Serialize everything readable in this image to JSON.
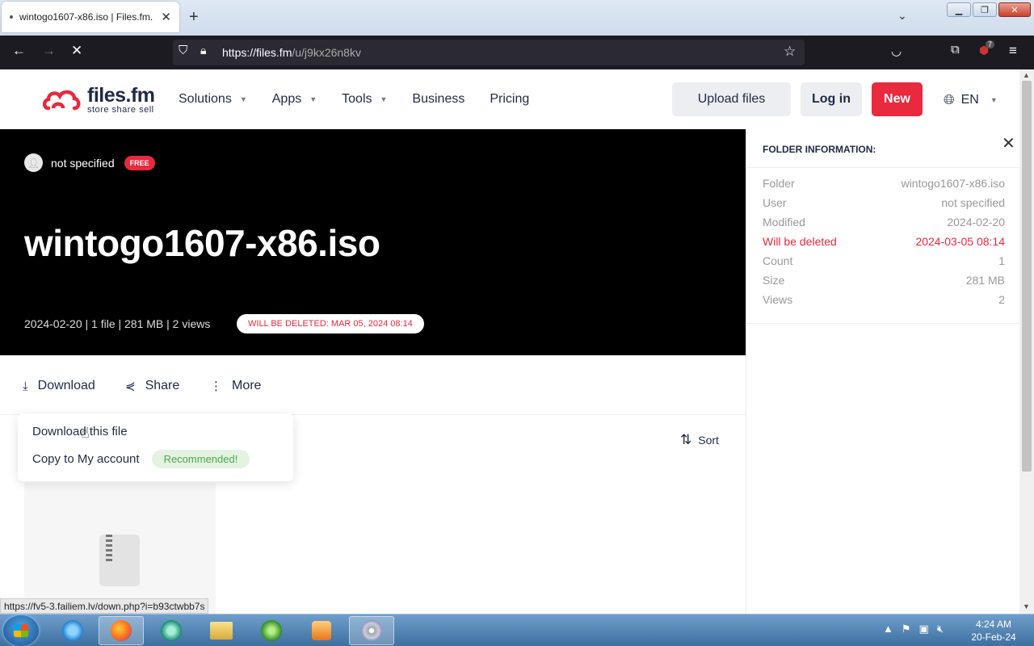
{
  "browser": {
    "tab_title": "wintogo1607-x86.iso | Files.fm.",
    "tab_close": "✕",
    "new_tab": "+",
    "url_host": "https://files.fm",
    "url_path": "/u/j9kx26n8kv",
    "extension_badge": "7",
    "status_url": "https://fv5-3.failiem.lv/down.php?i=b93ctwbb7s"
  },
  "header": {
    "logo_brand": "files.fm",
    "logo_tagline": "store share sell",
    "menu": [
      {
        "label": "Solutions",
        "has_caret": true
      },
      {
        "label": "Apps",
        "has_caret": true
      },
      {
        "label": "Tools",
        "has_caret": true
      },
      {
        "label": "Business",
        "has_caret": false
      },
      {
        "label": "Pricing",
        "has_caret": false
      }
    ],
    "upload_label": "Upload files",
    "login_label": "Log in",
    "new_label": "New",
    "language": "EN"
  },
  "hero": {
    "owner": "not specified",
    "plan_badge": "FREE",
    "title": "wintogo1607-x86.iso",
    "meta": "2024-02-20 | 1 file | 281 MB | 2 views",
    "deletion_notice": "WILL BE DELETED: MAR 05, 2024 08:14"
  },
  "actions": {
    "download": "Download",
    "share": "Share",
    "more": "More",
    "sort": "Sort"
  },
  "dropdown": {
    "download_file": "Download this file",
    "copy_account": "Copy to My account",
    "recommended": "Recommended!"
  },
  "folder_info": {
    "title": "FOLDER INFORMATION:",
    "rows": [
      {
        "label": "Folder",
        "value": "wintogo1607-x86.iso"
      },
      {
        "label": "User",
        "value": "not specified"
      },
      {
        "label": "Modified",
        "value": "2024-02-20"
      },
      {
        "label": "Will be deleted",
        "value": "2024-03-05 08:14",
        "warning": true
      },
      {
        "label": "Count",
        "value": "1"
      },
      {
        "label": "Size",
        "value": "281 MB"
      },
      {
        "label": "Views",
        "value": "2"
      }
    ]
  },
  "taskbar": {
    "time": "4:24 AM",
    "date": "20-Feb-24"
  },
  "colors": {
    "brand_red": "#e8293e",
    "hero_bg": "#000000",
    "browser_dark": "#1c1b22"
  }
}
